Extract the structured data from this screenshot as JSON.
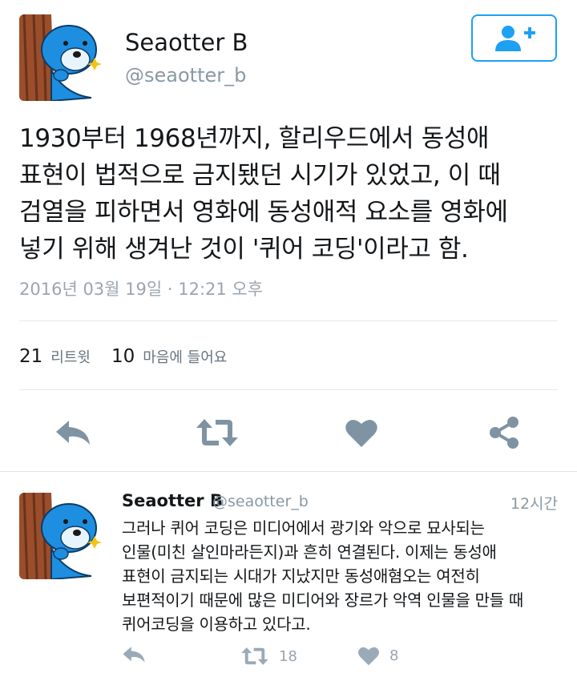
{
  "tweet": {
    "author_name": "Seaotter B",
    "author_handle": "@seaotter_b",
    "text": "1930부터 1968년까지, 할리우드에서 동성애\n표현이 법적으로 금지됐던 시기가 있었고, 이 때\n검열을 피하면서 영화에 동성애적 요소를 영화에\n넣기 위해 생겨난 것이 '퀴어 코딩'이라고 함.",
    "timestamp": "2016년 03월 19일 · 12:21 오후",
    "retweet_count": "21",
    "retweet_label": "리트윗",
    "like_count": "10",
    "like_label": "마음에 들어요"
  },
  "reply": {
    "author_name": "Seaotter B",
    "author_handle": "@seaotter_b",
    "time_ago": "12시간",
    "text": "그러나 퀴어 코딩은 미디어에서 광기와 악으로 묘사되는\n인물(미친 살인마라든지)과 흔히 연결된다. 이제는 동성애\n표현이 금지되는 시대가 지났지만 동성애혐오는 여전히\n보편적이기 때문에 많은 미디어와 장르가 악역 인물을 만들 때\n퀴어코딩을 이용하고 있다고.",
    "retweet_count": "18",
    "like_count": "8"
  },
  "colors": {
    "accent": "#1da1f2",
    "action_icon": "#7f93a3",
    "text_secondary": "#8899a6"
  },
  "icons": [
    "add-user-icon",
    "reply-icon",
    "retweet-icon",
    "heart-icon",
    "share-icon"
  ]
}
